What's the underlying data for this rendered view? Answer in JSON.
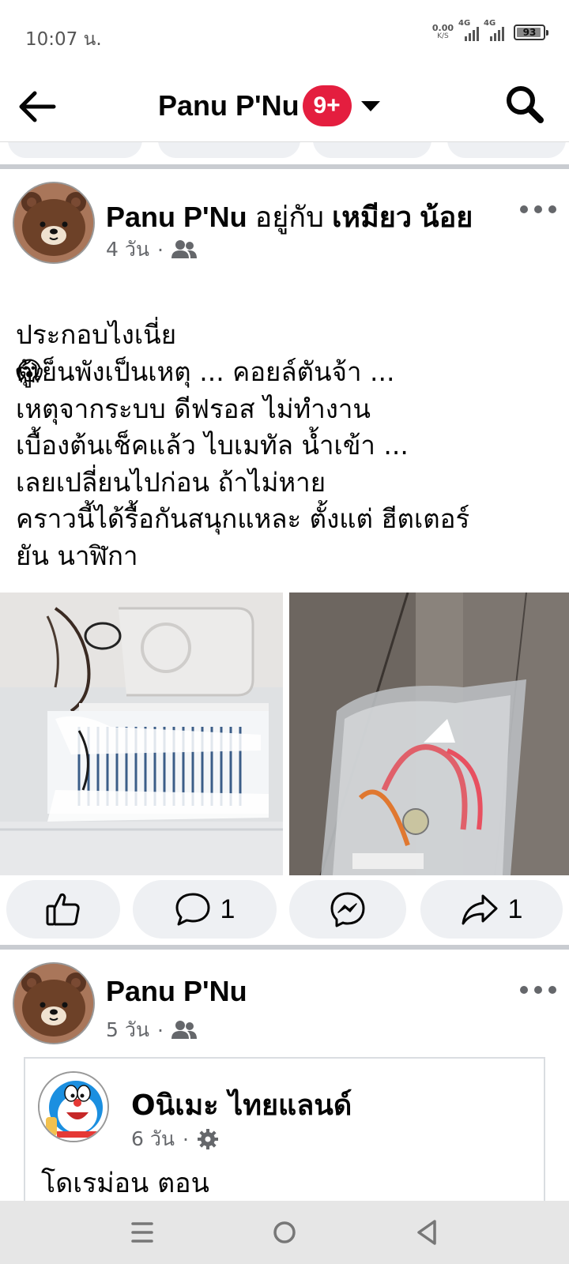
{
  "status_bar": {
    "time": "10:07 น.",
    "net_speed_value": "0.00",
    "net_speed_unit": "K/S",
    "signal1_label": "4G",
    "signal2_label": "4G",
    "battery_level": "93"
  },
  "header": {
    "title": "Panu P'Nu",
    "badge": "9+"
  },
  "posts": [
    {
      "author": "Panu P'Nu",
      "with_word": "อยู่กับ",
      "tagged": "เหมียว น้อย",
      "time": "4 วัน",
      "first_line": "ประกอบไงเนี่ย",
      "emoji": "😱",
      "body": "ตู้เย็นพังเป็นเหตุ ... คอยล์ตันจ้า ...\nเหตุจากระบบ ดีฟรอส ไม่ทำงาน\nเบื้องต้นเช็คแล้ว ไบเมทัล น้ำเข้า ...\nเลยเปลี่ยนไปก่อน ถ้าไม่หาย\nคราวนี้ได้รื้อกันสนุกแหละ ตั้งแต่ ฮีตเตอร์\nยัน นาฬิกา",
      "comment_count": "1",
      "share_count": "1"
    },
    {
      "author": "Panu P'Nu",
      "time": "5 วัน",
      "shared": {
        "name": "Oนิเมะ ไทยแลนด์",
        "time": "6 วัน",
        "text": "โดเรม่อน ตอน"
      }
    }
  ],
  "icons": {
    "back": "arrow-left-icon",
    "search": "search-icon",
    "audience": "friends-icon",
    "settings": "gear-icon",
    "like": "thumbs-up-icon",
    "comment": "comment-bubble-icon",
    "messenger": "messenger-icon",
    "share": "share-arrow-icon"
  },
  "colors": {
    "badge": "#e41e3f",
    "secondary_text": "#65676b",
    "button_bg": "#eef0f3"
  }
}
